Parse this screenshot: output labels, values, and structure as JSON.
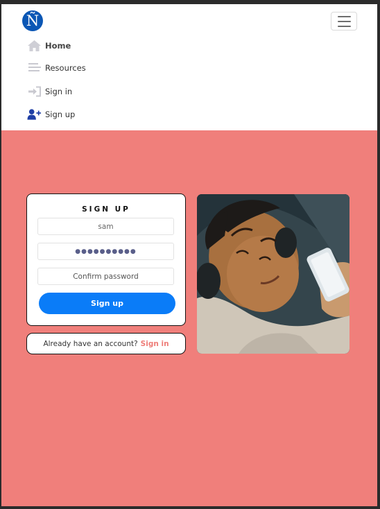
{
  "brand": {
    "logo_char": "Ñ"
  },
  "nav": {
    "items": [
      {
        "label": "Home",
        "icon": "home-icon"
      },
      {
        "label": "Resources",
        "icon": "list-icon"
      },
      {
        "label": "Sign in",
        "icon": "sign-in-icon"
      },
      {
        "label": "Sign up",
        "icon": "user-plus-icon"
      }
    ]
  },
  "signup_form": {
    "title": "SIGN UP",
    "username_value": "sam",
    "password_value": "●●●●●●●●●●",
    "confirm_placeholder": "Confirm password",
    "submit_label": "Sign up"
  },
  "signin_prompt": {
    "text": "Already have an account?",
    "link": "Sign in"
  },
  "colors": {
    "page_bg": "#f07f7b",
    "primary_button": "#0a7cf8",
    "link": "#ee7d78",
    "logo": "#0b57b5",
    "nav_signup_icon": "#1f3fa6"
  }
}
